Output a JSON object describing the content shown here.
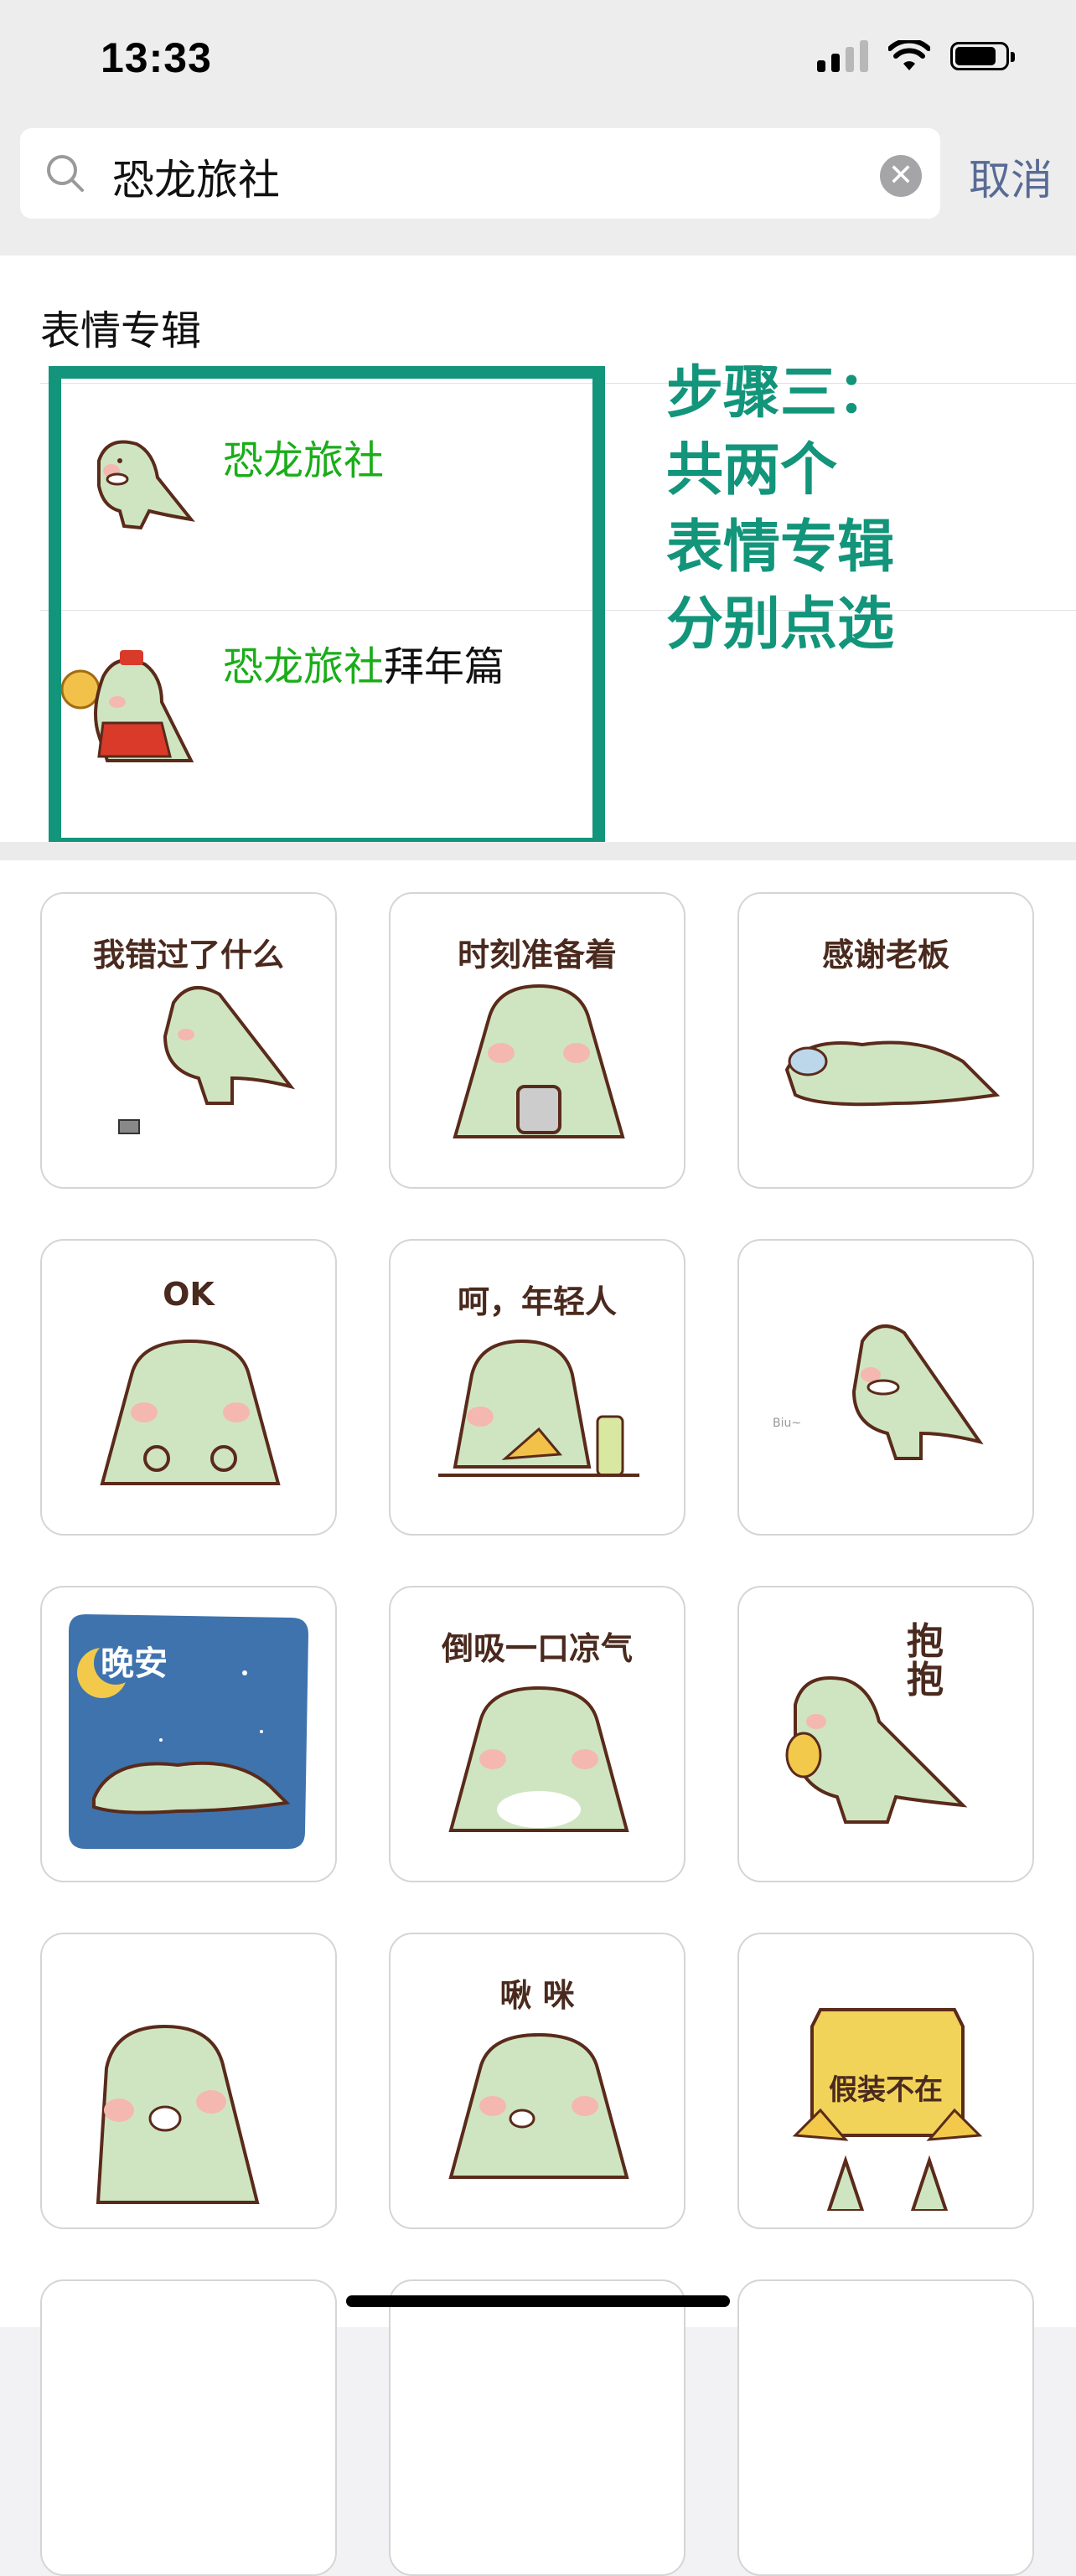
{
  "status_bar": {
    "time": "13:33"
  },
  "search": {
    "query": "恐龙旅社",
    "cancel_label": "取消"
  },
  "section": {
    "title": "表情专辑"
  },
  "albums": [
    {
      "name_highlight": "恐龙旅社",
      "name_rest": ""
    },
    {
      "name_highlight": "恐龙旅社",
      "name_rest": "拜年篇"
    }
  ],
  "annotation": {
    "lines": [
      "步骤三：",
      "共两个",
      "表情专辑",
      "分别点选"
    ]
  },
  "stickers": [
    {
      "caption": "我错过了什么"
    },
    {
      "caption": "时刻准备着"
    },
    {
      "caption": "感谢老板"
    },
    {
      "caption": "OK"
    },
    {
      "caption": "呵，年轻人"
    },
    {
      "caption": "Biu~"
    },
    {
      "caption": "晚安"
    },
    {
      "caption": "倒吸一口凉气"
    },
    {
      "caption": "抱抱"
    },
    {
      "caption": ""
    },
    {
      "caption": "啾 咪"
    },
    {
      "caption": "假装不在"
    }
  ],
  "colors": {
    "accent_green": "#1aad19",
    "annotation": "#12957a",
    "cancel_blue": "#576b95",
    "dino_green": "#cfe5c2",
    "outline": "#5a2a1a"
  }
}
